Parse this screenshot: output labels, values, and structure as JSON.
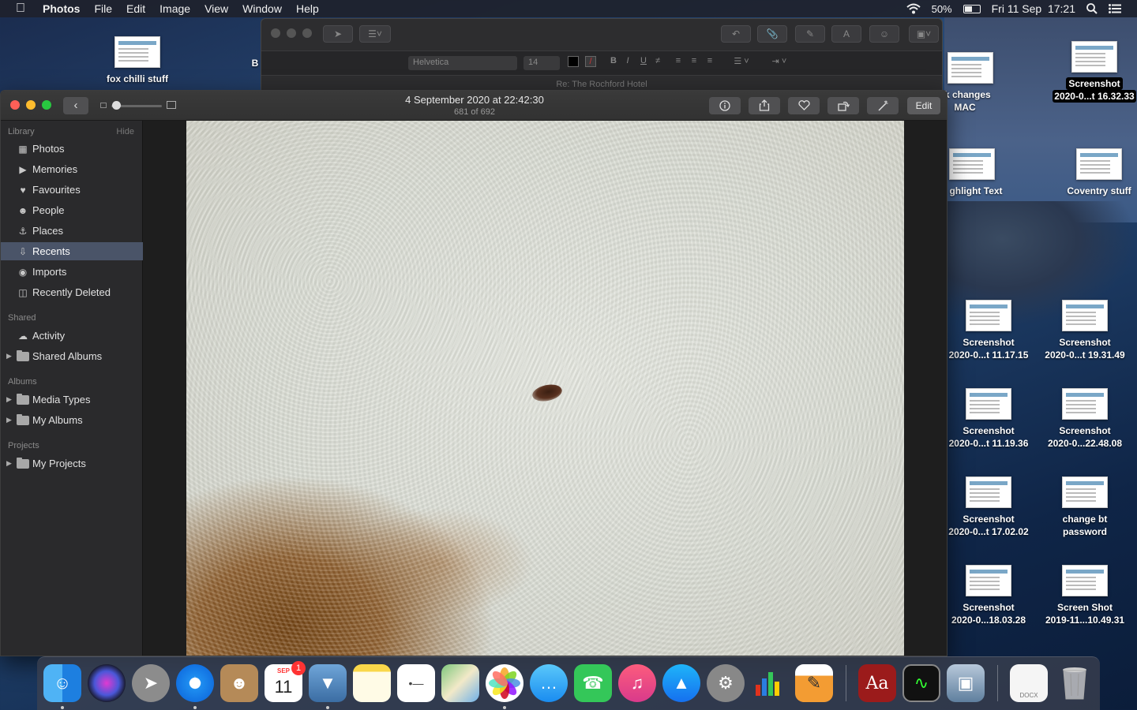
{
  "menubar": {
    "app_name": "Photos",
    "menus": [
      "File",
      "Edit",
      "Image",
      "View",
      "Window",
      "Help"
    ],
    "battery": "50%",
    "battery_level": 0.5,
    "clock": "Fri 11 Sep  17:21"
  },
  "mail_window": {
    "font": "Helvetica",
    "size": "14",
    "subject": "Re: The Rochford Hotel"
  },
  "photos_window": {
    "title": "4 September 2020 at 22:42:30",
    "subtitle": "681 of 692",
    "edit_label": "Edit",
    "sidebar": {
      "library_header": "Library",
      "hide_label": "Hide",
      "library_items": [
        "Photos",
        "Memories",
        "Favourites",
        "People",
        "Places",
        "Recents",
        "Imports",
        "Recently Deleted"
      ],
      "selected": "Recents",
      "shared_header": "Shared",
      "shared_items": [
        "Activity",
        "Shared Albums"
      ],
      "albums_header": "Albums",
      "album_items": [
        "Media Types",
        "My Albums"
      ],
      "projects_header": "Projects",
      "project_items": [
        "My Projects"
      ]
    }
  },
  "desktop_icons": [
    {
      "name": "fox chilli stuff",
      "sub": ""
    },
    {
      "name": "B",
      "sub": ""
    },
    {
      "name": "ck changes",
      "sub": "MAC"
    },
    {
      "name": "Screenshot",
      "sub": "2020-0...t 16.32.33"
    },
    {
      "name": "ghlight Text",
      "sub": ""
    },
    {
      "name": "Coventry  stuff",
      "sub": ""
    },
    {
      "name": "Screenshot",
      "sub": "2020-0...t 11.17.15"
    },
    {
      "name": "Screenshot",
      "sub": "2020-0...t 19.31.49"
    },
    {
      "name": "Screenshot",
      "sub": "2020-0...t 11.19.36"
    },
    {
      "name": "Screenshot",
      "sub": "2020-0...22.48.08"
    },
    {
      "name": "Screenshot",
      "sub": "2020-0...t 17.02.02"
    },
    {
      "name": "change bt",
      "sub": "password"
    },
    {
      "name": "Screenshot",
      "sub": "2020-0...18.03.28"
    },
    {
      "name": "Screen Shot",
      "sub": "2019-11...10.49.31"
    }
  ],
  "dock": {
    "calendar_month": "SEP",
    "calendar_day": "11",
    "calendar_badge": "1",
    "doc_label": "DOCX",
    "apps": [
      "finder",
      "siri",
      "launchpad",
      "safari",
      "contacts",
      "calendar",
      "preview",
      "notes",
      "reminders",
      "maps",
      "photos",
      "messages",
      "facetime",
      "music",
      "app-store",
      "system-preferences",
      "numbers",
      "pages",
      "dictionary",
      "activity-monitor",
      "image-capture",
      "document",
      "trash"
    ]
  }
}
